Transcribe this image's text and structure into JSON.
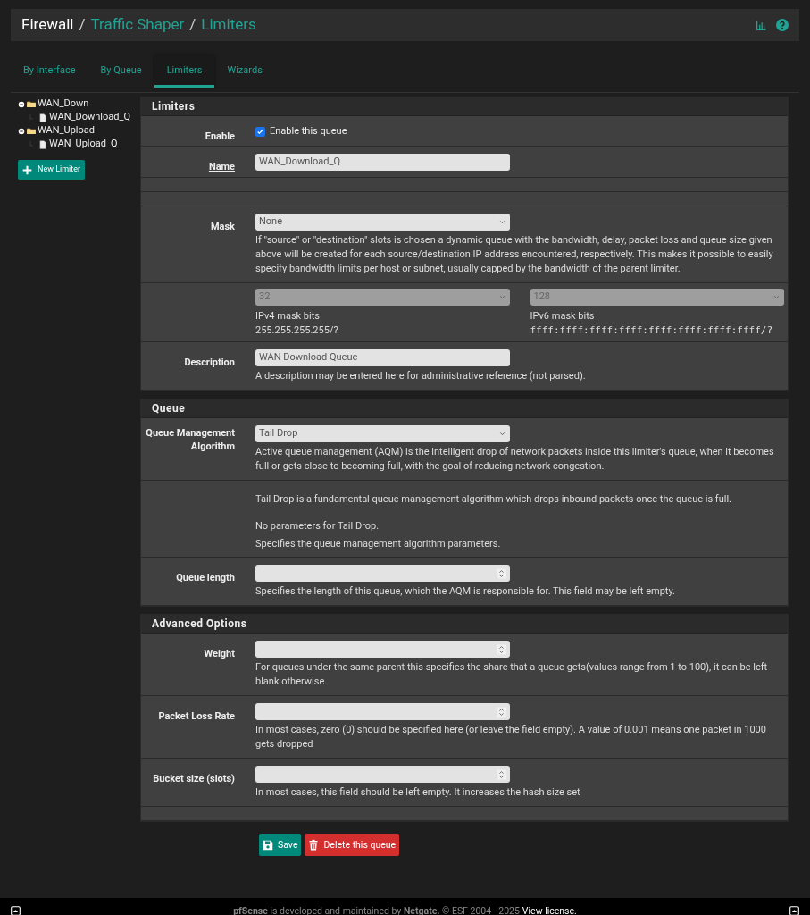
{
  "breadcrumb_separator": "/",
  "breadcrumb": [
    {
      "text": "Firewall",
      "link": false
    },
    {
      "text": "Traffic Shaper",
      "link": true
    },
    {
      "text": "Limiters",
      "link": true
    }
  ],
  "tabs": [
    {
      "label": "By Interface",
      "selected": false
    },
    {
      "label": "By Queue",
      "selected": false
    },
    {
      "label": "Limiters",
      "selected": true
    },
    {
      "label": "Wizards",
      "selected": false
    }
  ],
  "tree": [
    {
      "label": "WAN_Down",
      "expanded": true,
      "children": [
        {
          "label": "WAN_Download_Q"
        }
      ]
    },
    {
      "label": "WAN_Upload",
      "expanded": true,
      "children": [
        {
          "label": "WAN_Upload_Q"
        }
      ]
    }
  ],
  "new_limiter_button": "New Limiter",
  "sections": [
    {
      "title": "Limiters",
      "rows": [
        {
          "kind": "checkbox",
          "label": "Enable",
          "required": false,
          "checked": true,
          "text": "Enable this queue"
        },
        {
          "kind": "text",
          "label": "Name",
          "required": true,
          "value": "WAN_Download_Q"
        },
        {
          "kind": "blank"
        },
        {
          "kind": "blank"
        },
        {
          "kind": "select",
          "label": "Mask",
          "required": false,
          "value": "None",
          "help": "If \"source\" or \"destination\" slots is chosen a dynamic queue with the bandwidth, delay, packet loss and queue size given above will be created for each source/destination IP address encountered, respectively. This makes it possible to easily specify bandwidth limits per host or subnet, usually capped by the bandwidth of the parent limiter."
        },
        {
          "kind": "pair",
          "columns": [
            {
              "value": "32",
              "disabled": true,
              "caption": "IPv4 mask bits",
              "hint": "255.255.255.255/?",
              "mono": false
            },
            {
              "value": "128",
              "disabled": true,
              "caption": "IPv6 mask bits",
              "hint": "ffff:ffff:ffff:ffff:ffff:ffff:ffff:ffff/?",
              "mono": true
            }
          ]
        },
        {
          "kind": "text",
          "label": "Description",
          "required": false,
          "value": "WAN Download Queue",
          "help": "A description may be entered here for administrative reference (not parsed)."
        }
      ]
    },
    {
      "title": "Queue",
      "rows": [
        {
          "kind": "select",
          "label": "Queue Management Algorithm",
          "required": false,
          "value": "Tail Drop",
          "help": "Active queue management (AQM) is the intelligent drop of network packets inside this limiter's queue, when it becomes full or gets close to becoming full, with the goal of reducing network congestion."
        },
        {
          "kind": "info",
          "paragraphs": [
            "Tail Drop is a fundamental queue management algorithm which drops inbound packets once the queue is full.",
            "No parameters for Tail Drop.",
            "Specifies the queue management algorithm parameters."
          ]
        },
        {
          "kind": "number",
          "label": "Queue length",
          "required": false,
          "help": "Specifies the length of this queue, which the AQM is responsible for. This field may be left empty."
        }
      ]
    },
    {
      "title": "Advanced Options",
      "rows": [
        {
          "kind": "number",
          "label": "Weight",
          "required": false,
          "help": "For queues under the same parent this specifies the share that a queue gets(values range from 1 to 100), it can be left blank otherwise."
        },
        {
          "kind": "number",
          "label": "Packet Loss Rate",
          "required": false,
          "help": "In most cases, zero (0) should be specified here (or leave the field empty). A value of 0.001 means one packet in 1000 gets dropped"
        },
        {
          "kind": "number",
          "label": "Bucket size (slots)",
          "required": false,
          "help": "In most cases, this field should be left empty. It increases the hash size set"
        },
        {
          "kind": "blank"
        }
      ]
    }
  ],
  "buttons": [
    {
      "kind": "save",
      "label": "Save"
    },
    {
      "kind": "delete",
      "label": "Delete this queue"
    }
  ],
  "footer": {
    "text": "**pfSense** is developed and maintained by **Netgate.** © ESF 2004 - 2025",
    "link": "View license."
  }
}
